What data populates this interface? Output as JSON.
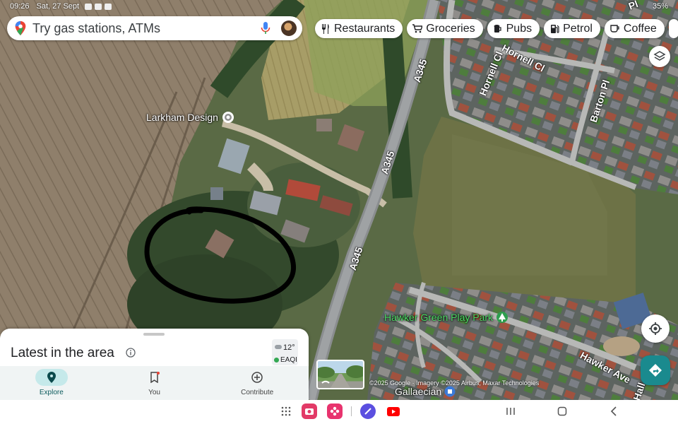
{
  "status_bar": {
    "time": "09:26",
    "date": "Sat, 27 Sept",
    "battery": "35%"
  },
  "search": {
    "placeholder": "Try gas stations, ATMs"
  },
  "chips": [
    {
      "label": "Restaurants",
      "icon": "fork-knife-icon"
    },
    {
      "label": "Groceries",
      "icon": "cart-icon"
    },
    {
      "label": "Pubs",
      "icon": "beer-mug-icon"
    },
    {
      "label": "Petrol",
      "icon": "fuel-pump-icon"
    },
    {
      "label": "Coffee",
      "icon": "coffee-cup-icon"
    }
  ],
  "map": {
    "places": {
      "larkham": "Larkham Design",
      "play_park": "Hawker Green Play Park",
      "gallaecian": "Gallaecian"
    },
    "roads": {
      "a345_1": "A345",
      "a345_2": "A345",
      "a345_3": "A345",
      "hornell_1": "Hornell Cl",
      "hornell_2": "Hornell Cl",
      "barton": "Barton Pl",
      "hawker": "Hawker Ave",
      "hall": "Hall",
      "top_right": "Pl"
    },
    "copyright": "©2025 Google · Imagery ©2025 Airbus, Maxar Technologies"
  },
  "sheet": {
    "title": "Latest in the area",
    "weather": {
      "temp": "12°",
      "aqi": "EAQI"
    },
    "nav": [
      {
        "label": "Explore",
        "icon": "explore-pin-icon",
        "active": true
      },
      {
        "label": "You",
        "icon": "bookmark-icon",
        "active": false
      },
      {
        "label": "Contribute",
        "icon": "add-circle-icon",
        "active": false
      }
    ]
  },
  "colors": {
    "place_label": "#ffffff",
    "park_label": "#4cd964",
    "accent_teal": "#1a8a8e",
    "annotation": "#000000"
  }
}
